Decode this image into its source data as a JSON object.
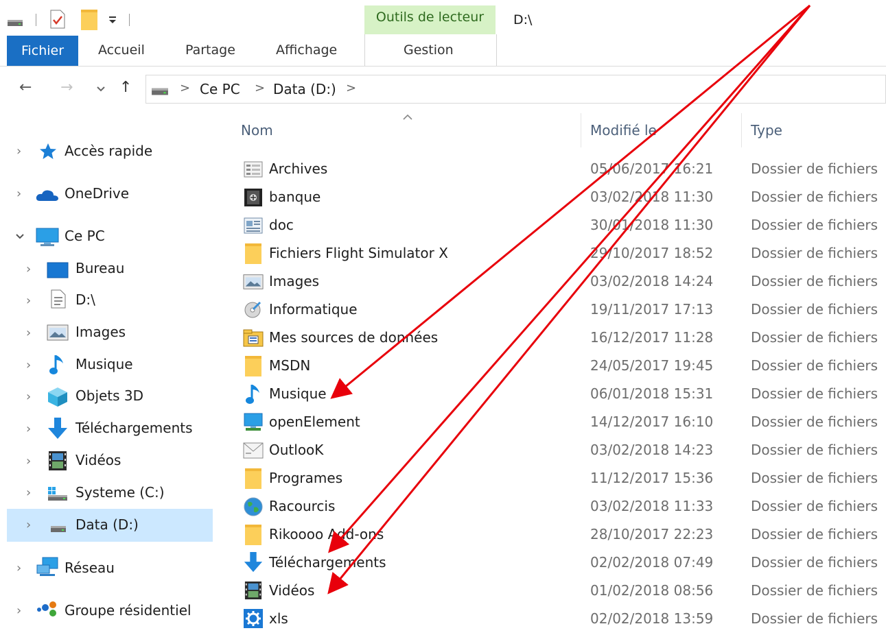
{
  "title_bar": {
    "context_tab_label": "Outils de lecteur",
    "window_title": "D:\\",
    "context_color": "#d7f2c6"
  },
  "ribbon": {
    "tabs": [
      "Fichier",
      "Accueil",
      "Partage",
      "Affichage",
      "Gestion"
    ],
    "active_color": "#1a6fc4"
  },
  "address": {
    "crumbs": [
      "Ce PC",
      "Data (D:)"
    ],
    "separator": ">"
  },
  "nav_pane": {
    "items": [
      {
        "label": "Accès rapide",
        "icon": "star-icon"
      },
      {
        "label": "OneDrive",
        "icon": "cloud-icon"
      },
      {
        "label": "Ce PC",
        "icon": "computer-icon"
      },
      {
        "label": "Bureau",
        "icon": "desktop-icon"
      },
      {
        "label": "D:\\",
        "icon": "document-icon"
      },
      {
        "label": "Images",
        "icon": "images-icon"
      },
      {
        "label": "Musique",
        "icon": "music-icon"
      },
      {
        "label": "Objets 3D",
        "icon": "cube-icon"
      },
      {
        "label": "Téléchargements",
        "icon": "download-icon"
      },
      {
        "label": "Vidéos",
        "icon": "film-icon"
      },
      {
        "label": "Systeme (C:)",
        "icon": "drive-c-icon"
      },
      {
        "label": "Data (D:)",
        "icon": "drive-icon"
      },
      {
        "label": "Réseau",
        "icon": "network-icon"
      },
      {
        "label": "Groupe résidentiel",
        "icon": "homegroup-icon"
      }
    ],
    "selected": "Data (D:)",
    "selected_color": "#cce8ff"
  },
  "file_list": {
    "columns": {
      "name": "Nom",
      "modified": "Modifié le",
      "type": "Type"
    },
    "rows": [
      {
        "name": "Archives",
        "modified": "05/06/2017 16:21",
        "type": "Dossier de fichiers",
        "icon": "archive-folder-icon"
      },
      {
        "name": "banque",
        "modified": "03/02/2018 11:30",
        "type": "Dossier de fichiers",
        "icon": "safe-folder-icon"
      },
      {
        "name": "doc",
        "modified": "30/01/2018 11:30",
        "type": "Dossier de fichiers",
        "icon": "doc-folder-icon"
      },
      {
        "name": "Fichiers Flight Simulator X",
        "modified": "29/10/2017 18:52",
        "type": "Dossier de fichiers",
        "icon": "folder-icon"
      },
      {
        "name": "Images",
        "modified": "03/02/2018 14:24",
        "type": "Dossier de fichiers",
        "icon": "images-icon"
      },
      {
        "name": "Informatique",
        "modified": "19/11/2017 17:13",
        "type": "Dossier de fichiers",
        "icon": "disc-icon"
      },
      {
        "name": "Mes sources de données",
        "modified": "16/12/2017 11:28",
        "type": "Dossier de fichiers",
        "icon": "datasource-folder-icon"
      },
      {
        "name": "MSDN",
        "modified": "24/05/2017 19:45",
        "type": "Dossier de fichiers",
        "icon": "folder-icon"
      },
      {
        "name": "Musique",
        "modified": "06/01/2018 15:31",
        "type": "Dossier de fichiers",
        "icon": "music-icon"
      },
      {
        "name": "openElement",
        "modified": "14/12/2017 16:10",
        "type": "Dossier de fichiers",
        "icon": "monitor-icon"
      },
      {
        "name": "OutlooK",
        "modified": "03/02/2018 14:23",
        "type": "Dossier de fichiers",
        "icon": "mail-folder-icon"
      },
      {
        "name": "Programes",
        "modified": "11/12/2017 15:36",
        "type": "Dossier de fichiers",
        "icon": "folder-icon"
      },
      {
        "name": "Racourcis",
        "modified": "03/02/2018 11:33",
        "type": "Dossier de fichiers",
        "icon": "globe-icon"
      },
      {
        "name": "Rikoooo Add-ons",
        "modified": "28/10/2017 22:23",
        "type": "Dossier de fichiers",
        "icon": "folder-icon"
      },
      {
        "name": "Téléchargements",
        "modified": "02/02/2018 07:49",
        "type": "Dossier de fichiers",
        "icon": "download-icon"
      },
      {
        "name": "Vidéos",
        "modified": "01/02/2018 08:56",
        "type": "Dossier de fichiers",
        "icon": "film-icon"
      },
      {
        "name": "xls",
        "modified": "02/02/2018 13:59",
        "type": "Dossier de fichiers",
        "icon": "gear-folder-icon"
      }
    ]
  },
  "annotation": {
    "arrow_color": "#e8000b"
  }
}
